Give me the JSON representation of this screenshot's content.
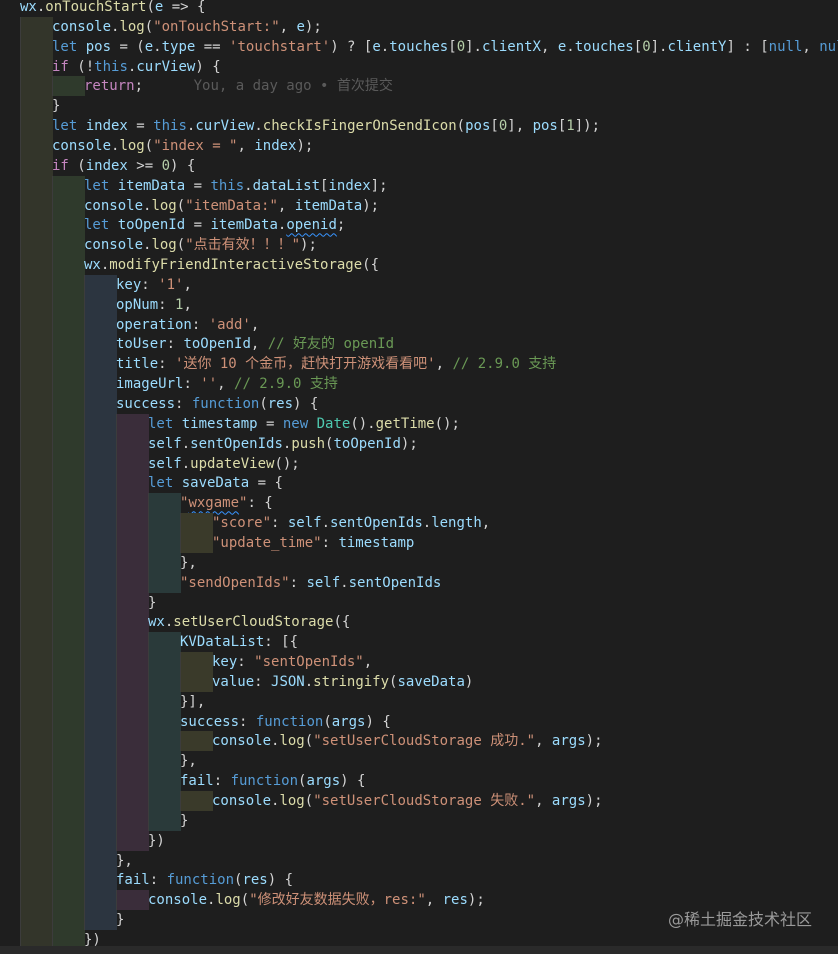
{
  "editor": {
    "lines": [
      [
        {
          "t": "wx",
          "c": "var"
        },
        {
          "t": ".",
          "c": "pun"
        },
        {
          "t": "onTouchStart",
          "c": "fn"
        },
        {
          "t": "(",
          "c": "pun"
        },
        {
          "t": "e",
          "c": "var"
        },
        {
          "t": " => {",
          "c": "pun"
        }
      ],
      [
        {
          "t": "console",
          "c": "var"
        },
        {
          "t": ".",
          "c": "pun"
        },
        {
          "t": "log",
          "c": "fn"
        },
        {
          "t": "(",
          "c": "pun"
        },
        {
          "t": "\"onTouchStart:\"",
          "c": "str"
        },
        {
          "t": ", ",
          "c": "pun"
        },
        {
          "t": "e",
          "c": "var"
        },
        {
          "t": ");",
          "c": "pun"
        }
      ],
      [
        {
          "t": "let ",
          "c": "kw"
        },
        {
          "t": "pos",
          "c": "var"
        },
        {
          "t": " = (",
          "c": "pun"
        },
        {
          "t": "e",
          "c": "var"
        },
        {
          "t": ".",
          "c": "pun"
        },
        {
          "t": "type",
          "c": "var"
        },
        {
          "t": " == ",
          "c": "pun"
        },
        {
          "t": "'touchstart'",
          "c": "str"
        },
        {
          "t": ") ? [",
          "c": "pun"
        },
        {
          "t": "e",
          "c": "var"
        },
        {
          "t": ".",
          "c": "pun"
        },
        {
          "t": "touches",
          "c": "var"
        },
        {
          "t": "[",
          "c": "pun"
        },
        {
          "t": "0",
          "c": "num"
        },
        {
          "t": "].",
          "c": "pun"
        },
        {
          "t": "clientX",
          "c": "var"
        },
        {
          "t": ", ",
          "c": "pun"
        },
        {
          "t": "e",
          "c": "var"
        },
        {
          "t": ".",
          "c": "pun"
        },
        {
          "t": "touches",
          "c": "var"
        },
        {
          "t": "[",
          "c": "pun"
        },
        {
          "t": "0",
          "c": "num"
        },
        {
          "t": "].",
          "c": "pun"
        },
        {
          "t": "clientY",
          "c": "var"
        },
        {
          "t": "] : [",
          "c": "pun"
        },
        {
          "t": "null",
          "c": "kw"
        },
        {
          "t": ", ",
          "c": "pun"
        },
        {
          "t": "null",
          "c": "kw"
        },
        {
          "t": "]",
          "c": "pun"
        }
      ],
      [
        {
          "t": "if",
          "c": "ctl"
        },
        {
          "t": " (!",
          "c": "pun"
        },
        {
          "t": "this",
          "c": "kw"
        },
        {
          "t": ".",
          "c": "pun"
        },
        {
          "t": "curView",
          "c": "var"
        },
        {
          "t": ") ",
          "c": "pun"
        },
        {
          "t": "{",
          "c": "pun"
        }
      ],
      [
        {
          "t": "return",
          "c": "ctl"
        },
        {
          "t": ";",
          "c": "pun"
        },
        {
          "t": "      You, a day ago • 首次提交",
          "c": "blame"
        }
      ],
      [
        {
          "t": "}",
          "c": "pun"
        }
      ],
      [
        {
          "t": "let ",
          "c": "kw"
        },
        {
          "t": "index",
          "c": "var"
        },
        {
          "t": " = ",
          "c": "pun"
        },
        {
          "t": "this",
          "c": "kw"
        },
        {
          "t": ".",
          "c": "pun"
        },
        {
          "t": "curView",
          "c": "var"
        },
        {
          "t": ".",
          "c": "pun"
        },
        {
          "t": "checkIsFingerOnSendIcon",
          "c": "fn"
        },
        {
          "t": "(",
          "c": "pun"
        },
        {
          "t": "pos",
          "c": "var"
        },
        {
          "t": "[",
          "c": "pun"
        },
        {
          "t": "0",
          "c": "num"
        },
        {
          "t": "], ",
          "c": "pun"
        },
        {
          "t": "pos",
          "c": "var"
        },
        {
          "t": "[",
          "c": "pun"
        },
        {
          "t": "1",
          "c": "num"
        },
        {
          "t": "]);",
          "c": "pun"
        }
      ],
      [
        {
          "t": "console",
          "c": "var"
        },
        {
          "t": ".",
          "c": "pun"
        },
        {
          "t": "log",
          "c": "fn"
        },
        {
          "t": "(",
          "c": "pun"
        },
        {
          "t": "\"index = \"",
          "c": "str"
        },
        {
          "t": ", ",
          "c": "pun"
        },
        {
          "t": "index",
          "c": "var"
        },
        {
          "t": ");",
          "c": "pun"
        }
      ],
      [
        {
          "t": "if",
          "c": "ctl"
        },
        {
          "t": " (",
          "c": "pun"
        },
        {
          "t": "index",
          "c": "var"
        },
        {
          "t": " >= ",
          "c": "pun"
        },
        {
          "t": "0",
          "c": "num"
        },
        {
          "t": ") {",
          "c": "pun"
        }
      ],
      [
        {
          "t": "let ",
          "c": "kw"
        },
        {
          "t": "itemData",
          "c": "var"
        },
        {
          "t": " = ",
          "c": "pun"
        },
        {
          "t": "this",
          "c": "kw"
        },
        {
          "t": ".",
          "c": "pun"
        },
        {
          "t": "dataList",
          "c": "var"
        },
        {
          "t": "[",
          "c": "pun"
        },
        {
          "t": "index",
          "c": "var"
        },
        {
          "t": "];",
          "c": "pun"
        }
      ],
      [
        {
          "t": "console",
          "c": "var"
        },
        {
          "t": ".",
          "c": "pun"
        },
        {
          "t": "log",
          "c": "fn"
        },
        {
          "t": "(",
          "c": "pun"
        },
        {
          "t": "\"itemData:\"",
          "c": "str"
        },
        {
          "t": ", ",
          "c": "pun"
        },
        {
          "t": "itemData",
          "c": "var"
        },
        {
          "t": ");",
          "c": "pun"
        }
      ],
      [
        {
          "t": "let ",
          "c": "kw"
        },
        {
          "t": "toOpenId",
          "c": "var"
        },
        {
          "t": " = ",
          "c": "pun"
        },
        {
          "t": "itemData",
          "c": "var"
        },
        {
          "t": ".",
          "c": "pun"
        },
        {
          "t": "openid",
          "c": "var",
          "u": true
        },
        {
          "t": ";",
          "c": "pun"
        }
      ],
      [
        {
          "t": "console",
          "c": "var"
        },
        {
          "t": ".",
          "c": "pun"
        },
        {
          "t": "log",
          "c": "fn"
        },
        {
          "t": "(",
          "c": "pun"
        },
        {
          "t": "\"点击有效！！！\"",
          "c": "str"
        },
        {
          "t": ");",
          "c": "pun"
        }
      ],
      [
        {
          "t": "wx",
          "c": "var"
        },
        {
          "t": ".",
          "c": "pun"
        },
        {
          "t": "modifyFriendInteractiveStorage",
          "c": "fn"
        },
        {
          "t": "({",
          "c": "pun"
        }
      ],
      [
        {
          "t": "key",
          "c": "var"
        },
        {
          "t": ": ",
          "c": "pun"
        },
        {
          "t": "'1'",
          "c": "str"
        },
        {
          "t": ",",
          "c": "pun"
        }
      ],
      [
        {
          "t": "opNum",
          "c": "var"
        },
        {
          "t": ": ",
          "c": "pun"
        },
        {
          "t": "1",
          "c": "num"
        },
        {
          "t": ",",
          "c": "pun"
        }
      ],
      [
        {
          "t": "operation",
          "c": "var"
        },
        {
          "t": ": ",
          "c": "pun"
        },
        {
          "t": "'add'",
          "c": "str"
        },
        {
          "t": ",",
          "c": "pun"
        }
      ],
      [
        {
          "t": "toUser",
          "c": "var"
        },
        {
          "t": ": ",
          "c": "pun"
        },
        {
          "t": "toOpenId",
          "c": "var"
        },
        {
          "t": ", ",
          "c": "pun"
        },
        {
          "t": "// 好友的 openId",
          "c": "cmt"
        }
      ],
      [
        {
          "t": "title",
          "c": "var"
        },
        {
          "t": ": ",
          "c": "pun"
        },
        {
          "t": "'送你 10 个金币，赶快打开游戏看看吧'",
          "c": "str"
        },
        {
          "t": ", ",
          "c": "pun"
        },
        {
          "t": "// 2.9.0 支持",
          "c": "cmt"
        }
      ],
      [
        {
          "t": "imageUrl",
          "c": "var"
        },
        {
          "t": ": ",
          "c": "pun"
        },
        {
          "t": "''",
          "c": "str"
        },
        {
          "t": ", ",
          "c": "pun"
        },
        {
          "t": "// 2.9.0 支持",
          "c": "cmt"
        }
      ],
      [
        {
          "t": "success",
          "c": "var"
        },
        {
          "t": ": ",
          "c": "pun"
        },
        {
          "t": "function",
          "c": "kw"
        },
        {
          "t": "(",
          "c": "pun"
        },
        {
          "t": "res",
          "c": "var"
        },
        {
          "t": ") {",
          "c": "pun"
        }
      ],
      [
        {
          "t": "let ",
          "c": "kw"
        },
        {
          "t": "timestamp",
          "c": "var"
        },
        {
          "t": " = ",
          "c": "pun"
        },
        {
          "t": "new ",
          "c": "kw"
        },
        {
          "t": "Date",
          "c": "cls"
        },
        {
          "t": "().",
          "c": "pun"
        },
        {
          "t": "getTime",
          "c": "fn"
        },
        {
          "t": "();",
          "c": "pun"
        }
      ],
      [
        {
          "t": "self",
          "c": "var"
        },
        {
          "t": ".",
          "c": "pun"
        },
        {
          "t": "sentOpenIds",
          "c": "var"
        },
        {
          "t": ".",
          "c": "pun"
        },
        {
          "t": "push",
          "c": "fn"
        },
        {
          "t": "(",
          "c": "pun"
        },
        {
          "t": "toOpenId",
          "c": "var"
        },
        {
          "t": ");",
          "c": "pun"
        }
      ],
      [
        {
          "t": "self",
          "c": "var"
        },
        {
          "t": ".",
          "c": "pun"
        },
        {
          "t": "updateView",
          "c": "fn"
        },
        {
          "t": "();",
          "c": "pun"
        }
      ],
      [
        {
          "t": "let ",
          "c": "kw"
        },
        {
          "t": "saveData",
          "c": "var"
        },
        {
          "t": " = {",
          "c": "pun"
        }
      ],
      [
        {
          "t": "\"",
          "c": "str"
        },
        {
          "t": "wxgame",
          "c": "str",
          "u": true
        },
        {
          "t": "\"",
          "c": "str"
        },
        {
          "t": ": {",
          "c": "pun"
        }
      ],
      [
        {
          "t": "\"score\"",
          "c": "str"
        },
        {
          "t": ": ",
          "c": "pun"
        },
        {
          "t": "self",
          "c": "var"
        },
        {
          "t": ".",
          "c": "pun"
        },
        {
          "t": "sentOpenIds",
          "c": "var"
        },
        {
          "t": ".",
          "c": "pun"
        },
        {
          "t": "length",
          "c": "var"
        },
        {
          "t": ",",
          "c": "pun"
        }
      ],
      [
        {
          "t": "\"update_time\"",
          "c": "str"
        },
        {
          "t": ": ",
          "c": "pun"
        },
        {
          "t": "timestamp",
          "c": "var"
        }
      ],
      [
        {
          "t": "},",
          "c": "pun"
        }
      ],
      [
        {
          "t": "\"sendOpenIds\"",
          "c": "str"
        },
        {
          "t": ": ",
          "c": "pun"
        },
        {
          "t": "self",
          "c": "var"
        },
        {
          "t": ".",
          "c": "pun"
        },
        {
          "t": "sentOpenIds",
          "c": "var"
        }
      ],
      [
        {
          "t": "}",
          "c": "pun"
        }
      ],
      [
        {
          "t": "wx",
          "c": "var"
        },
        {
          "t": ".",
          "c": "pun"
        },
        {
          "t": "setUserCloudStorage",
          "c": "fn"
        },
        {
          "t": "({",
          "c": "pun"
        }
      ],
      [
        {
          "t": "KVDataList",
          "c": "var"
        },
        {
          "t": ": [{",
          "c": "pun"
        }
      ],
      [
        {
          "t": "key",
          "c": "var"
        },
        {
          "t": ": ",
          "c": "pun"
        },
        {
          "t": "\"sentOpenIds\"",
          "c": "str"
        },
        {
          "t": ",",
          "c": "pun"
        }
      ],
      [
        {
          "t": "value",
          "c": "var"
        },
        {
          "t": ": ",
          "c": "pun"
        },
        {
          "t": "JSON",
          "c": "var"
        },
        {
          "t": ".",
          "c": "pun"
        },
        {
          "t": "stringify",
          "c": "fn"
        },
        {
          "t": "(",
          "c": "pun"
        },
        {
          "t": "saveData",
          "c": "var"
        },
        {
          "t": ")",
          "c": "pun"
        }
      ],
      [
        {
          "t": "}],",
          "c": "pun"
        }
      ],
      [
        {
          "t": "success",
          "c": "var"
        },
        {
          "t": ": ",
          "c": "pun"
        },
        {
          "t": "function",
          "c": "kw"
        },
        {
          "t": "(",
          "c": "pun"
        },
        {
          "t": "args",
          "c": "var"
        },
        {
          "t": ") {",
          "c": "pun"
        }
      ],
      [
        {
          "t": "console",
          "c": "var"
        },
        {
          "t": ".",
          "c": "pun"
        },
        {
          "t": "log",
          "c": "fn"
        },
        {
          "t": "(",
          "c": "pun"
        },
        {
          "t": "\"setUserCloudStorage 成功.\"",
          "c": "str"
        },
        {
          "t": ", ",
          "c": "pun"
        },
        {
          "t": "args",
          "c": "var"
        },
        {
          "t": ");",
          "c": "pun"
        }
      ],
      [
        {
          "t": "},",
          "c": "pun"
        }
      ],
      [
        {
          "t": "fail",
          "c": "var"
        },
        {
          "t": ": ",
          "c": "pun"
        },
        {
          "t": "function",
          "c": "kw"
        },
        {
          "t": "(",
          "c": "pun"
        },
        {
          "t": "args",
          "c": "var"
        },
        {
          "t": ") {",
          "c": "pun"
        }
      ],
      [
        {
          "t": "console",
          "c": "var"
        },
        {
          "t": ".",
          "c": "pun"
        },
        {
          "t": "log",
          "c": "fn"
        },
        {
          "t": "(",
          "c": "pun"
        },
        {
          "t": "\"setUserCloudStorage 失败.\"",
          "c": "str"
        },
        {
          "t": ", ",
          "c": "pun"
        },
        {
          "t": "args",
          "c": "var"
        },
        {
          "t": ");",
          "c": "pun"
        }
      ],
      [
        {
          "t": "}",
          "c": "pun"
        }
      ],
      [
        {
          "t": "})",
          "c": "pun"
        }
      ],
      [
        {
          "t": "},",
          "c": "pun"
        }
      ],
      [
        {
          "t": "fail",
          "c": "var"
        },
        {
          "t": ": ",
          "c": "pun"
        },
        {
          "t": "function",
          "c": "kw"
        },
        {
          "t": "(",
          "c": "pun"
        },
        {
          "t": "res",
          "c": "var"
        },
        {
          "t": ") {",
          "c": "pun"
        }
      ],
      [
        {
          "t": "console",
          "c": "var"
        },
        {
          "t": ".",
          "c": "pun"
        },
        {
          "t": "log",
          "c": "fn"
        },
        {
          "t": "(",
          "c": "pun"
        },
        {
          "t": "\"修改好友数据失败，res:\"",
          "c": "str"
        },
        {
          "t": ", ",
          "c": "pun"
        },
        {
          "t": "res",
          "c": "var"
        },
        {
          "t": ");",
          "c": "pun"
        }
      ],
      [
        {
          "t": "}",
          "c": "pun"
        }
      ],
      [
        {
          "t": "})",
          "c": "pun"
        }
      ]
    ],
    "colors": {
      "background": "#1e1e1e",
      "indent_guides": [
        "#33352a",
        "#2f3a2c",
        "#2c3540",
        "#3a2d3a",
        "#2a3a3a",
        "#3a3a2a"
      ]
    }
  },
  "watermark": "@稀土掘金技术社区"
}
